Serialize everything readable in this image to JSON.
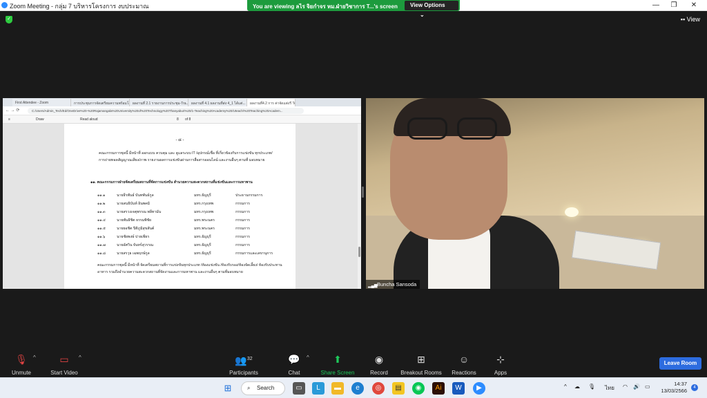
{
  "window": {
    "title": "Zoom Meeting - กลุ่ม 7 บริหารโครงการ งบประมาณ",
    "controls": [
      "—",
      "❐",
      "✕"
    ]
  },
  "banner": {
    "text": "You are viewing ลไร จิยกำจร หม.ฝ่ายวิชาการ T...'s screen",
    "view_options": "View Options"
  },
  "view_button": "View",
  "browser": {
    "tabs": [
      "First Attendee - Zoom",
      "การประชุมการจัดเตรียมความพร้อมโครง...",
      "ผลงานที่ 2.1 รายงานการประชุม-Tra...",
      "ผลงานที่ 4.1 ผลงานที่ส่ง 4_1 ได้แต่...",
      "ผลงานที่4.2 การ ค่าจัดแต่งรี Teach..."
    ],
    "url": "C:/Users/Admin_Tech/Ed/OneDrive%20-%20Rajamangala%20University%20of%20Technology%20Thanyaburi%20/1-Teaching%20Academy%20/Uteach/%20Teaching%20Academ...",
    "pdf_toolbar": {
      "draw": "Draw",
      "read_aloud": "Read aloud",
      "page": "8",
      "of_pages": "of 8"
    }
  },
  "doc": {
    "page_number": "- ๘ -",
    "para1": "คณะกรรมการชุดนี้ มีหน้าที่ ออกแบบ ควบคุม และ ดูแลระบบ IT /อุปกรณ์เชื่อ ที่เกี่ยวข้องกับการแข่งขัน ทุกประเภท/การถ่ายทอดสัญญาณเสียง/ภาพ รายงานผลการแข่งขันผ่านการสื่อสารออนไลน์ และงานอื่นๆ ตามที่ มอบหมาย",
    "heading": "๑๑. คณะกรรมการฝ่ายจัดเตรียมสถานที่จัดการแข่งขัน สำนวยความสะดวกสถานที่แข่งขันและการมหาพาน",
    "members": [
      {
        "no": "๑๑.๑",
        "name": "นายธีรพันธ์   บันทพันธ์กูล",
        "org": "มทร.ธัญบุรี",
        "role": "ประธานกรรมการ"
      },
      {
        "no": "๑๑.๒",
        "name": "นายสนธิบันท์   อินพคมิ",
        "org": "มทร.กรุงเทพ",
        "role": "กรรมการ"
      },
      {
        "no": "๑๑.๓",
        "name": "นายสรวงเจตุพรรณ พลีทามัน",
        "org": "มทร.กรุงเทพ",
        "role": "กรรมการ"
      },
      {
        "no": "๑๑.๔",
        "name": "นายพันธิชิต   ธรรมพิชัย",
        "org": "มทร.พระนคร",
        "role": "กรรมการ"
      },
      {
        "no": "๑๑.๕",
        "name": "นายยอชิต ปิติภูมิสุขสันต์",
        "org": "มทร.พระนคร",
        "role": "กรรมการ"
      },
      {
        "no": "๑๑.๖",
        "name": "นายชัยพงษ์   ปายเพียร",
        "org": "มทร.ธัญบุรี",
        "role": "กรรมการ"
      },
      {
        "no": "๑๑.๗",
        "name": "นายอัศวิน   จันทร์สุวรรณ",
        "org": "มทร.ธัญบุรี",
        "role": "กรรมการ"
      },
      {
        "no": "๑๑.๘",
        "name": "นายสรวุธ   เฉพฤกษ์กูล",
        "org": "มทร.ธัญบุรี",
        "role": "กรรมการและเลขานุการ"
      }
    ],
    "para2": "คณะกรรมการชุดนี้ มีหน้าที่ จัดเตรียมสถานที่การแข่งขันทุกประเภท /ห้องแข่งขัน /ห้องรับรอง/ห้องจัดเลี้ยง/ ห้องรับประทานอาหาร รวมถึงอำนวยความสะดวกสถานที่จัดงานและการมหาพาน และงานอื่นๆ ตามที่มอบหมาย"
  },
  "camera": {
    "name": "Buncha Sansoda"
  },
  "toolbar": {
    "unmute": "Unmute",
    "start_video": "Start Video",
    "participants": "Participants",
    "participant_count": "32",
    "chat": "Chat",
    "share_screen": "Share Screen",
    "record": "Record",
    "breakout": "Breakout Rooms",
    "reactions": "Reactions",
    "apps": "Apps",
    "leave": "Leave Room"
  },
  "taskbar": {
    "search": "Search",
    "lang": "ไทย",
    "time": "14:37",
    "date": "13/03/2566",
    "notif_count": "4"
  },
  "colors": {
    "banner": "#1d9b3d",
    "leave": "#2d6cdf",
    "share_green": "#1ec95b"
  }
}
